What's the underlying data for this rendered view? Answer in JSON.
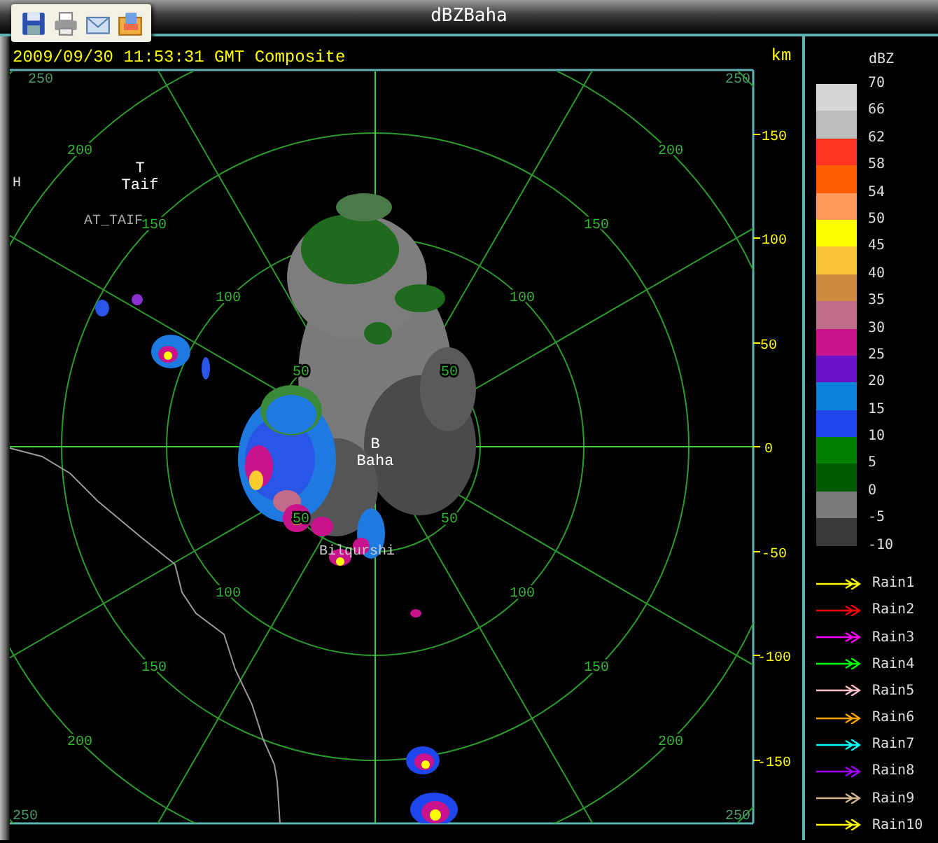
{
  "window": {
    "title": "dBZBaha"
  },
  "header": {
    "timestamp": "2009/09/30 11:53:31 GMT Composite",
    "unit": "km"
  },
  "map": {
    "places": [
      {
        "symbol": "T",
        "name": "Taif"
      },
      {
        "symbol": "B",
        "name": "Baha"
      }
    ],
    "site_labels": [
      "AT_TAIF",
      "Bilqurshi",
      "H"
    ],
    "range_labels": [
      "200",
      "150",
      "100",
      "50",
      "50",
      "100",
      "150",
      "200",
      "50",
      "50",
      "100",
      "100",
      "150",
      "150",
      "200",
      "200"
    ],
    "corner_labels": [
      "250",
      "250",
      "250",
      "250"
    ],
    "axis_labels": [
      "150",
      "100",
      "50",
      "0",
      "-50",
      "-100",
      "-150"
    ]
  },
  "legend": {
    "title": "dBZ",
    "bands": [
      {
        "color": "#d6d6d6"
      },
      {
        "color": "#bdbdbd"
      },
      {
        "color": "#ff3322"
      },
      {
        "color": "#ff5f00"
      },
      {
        "color": "#ff9a5a"
      },
      {
        "color": "#ffff00"
      },
      {
        "color": "#fcc43a"
      },
      {
        "color": "#d08a40"
      },
      {
        "color": "#c06c88"
      },
      {
        "color": "#c8138c"
      },
      {
        "color": "#6a12c8"
      },
      {
        "color": "#0a82dc"
      },
      {
        "color": "#1e46ec"
      },
      {
        "color": "#008000"
      },
      {
        "color": "#005c00"
      },
      {
        "color": "#7a7a7a"
      },
      {
        "color": "#3a3a3a"
      }
    ],
    "scale": [
      "70",
      "66",
      "62",
      "58",
      "54",
      "50",
      "45",
      "40",
      "35",
      "30",
      "25",
      "20",
      "15",
      "10",
      "5",
      "0",
      "-5",
      "-10"
    ],
    "tracks": [
      {
        "label": "Rain1",
        "color": "#ffff00"
      },
      {
        "label": "Rain2",
        "color": "#ff0000"
      },
      {
        "label": "Rain3",
        "color": "#ff00ff"
      },
      {
        "label": "Rain4",
        "color": "#00ff00"
      },
      {
        "label": "Rain5",
        "color": "#ffc0cb"
      },
      {
        "label": "Rain6",
        "color": "#ffa500"
      },
      {
        "label": "Rain7",
        "color": "#00ffff"
      },
      {
        "label": "Rain8",
        "color": "#a000ff"
      },
      {
        "label": "Rain9",
        "color": "#d2b48c"
      },
      {
        "label": "Rain10",
        "color": "#ffff00"
      }
    ]
  }
}
